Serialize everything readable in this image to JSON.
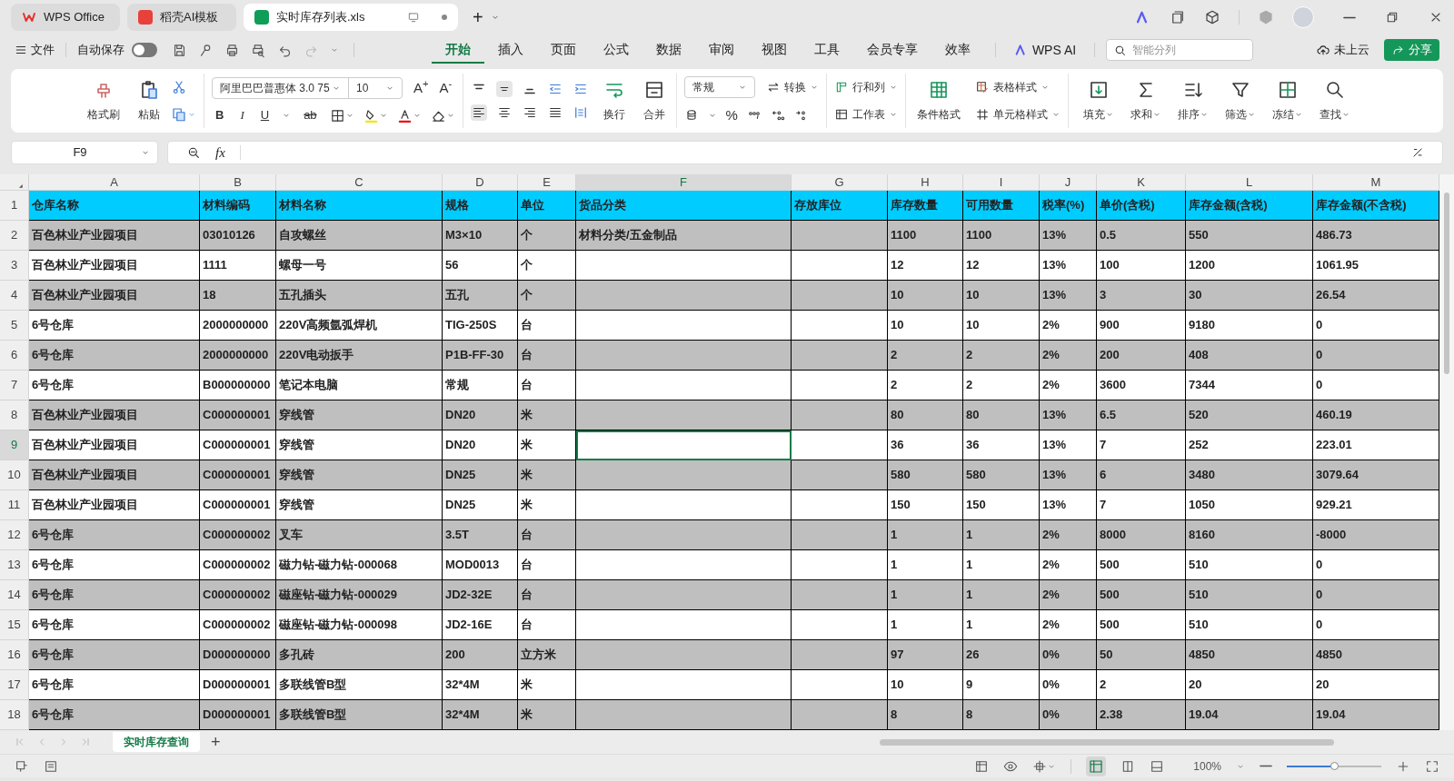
{
  "app_tabs": [
    {
      "label": "WPS Office",
      "selected": false
    },
    {
      "label": "稻壳AI模板",
      "selected": false
    },
    {
      "label": "实时库存列表.xls",
      "selected": true
    }
  ],
  "new_tab": "+",
  "menu": {
    "file": "文件",
    "autosave": {
      "label": "自动保存",
      "on": false
    },
    "tabs": [
      {
        "label": "开始",
        "selected": true
      },
      {
        "label": "插入",
        "selected": false
      },
      {
        "label": "页面",
        "selected": false
      },
      {
        "label": "公式",
        "selected": false
      },
      {
        "label": "数据",
        "selected": false
      },
      {
        "label": "审阅",
        "selected": false
      },
      {
        "label": "视图",
        "selected": false
      },
      {
        "label": "工具",
        "selected": false
      },
      {
        "label": "会员专享",
        "selected": false
      },
      {
        "label": "效率",
        "selected": false
      }
    ],
    "ai": "WPS AI",
    "search": {
      "placeholder": "智能分列"
    },
    "cloud": "未上云",
    "share": "分享"
  },
  "ribbon": {
    "format_painter": "格式刷",
    "paste": "粘贴",
    "font": "阿里巴巴普惠体 3.0 75",
    "font_size": "10",
    "font_grow": "A$^{+}$",
    "font_shrink": "A$^{-}$",
    "text_styles": [
      "B",
      "I",
      "U",
      "ab"
    ],
    "wrap": "换行",
    "merge": "合并",
    "number_format": "常规",
    "convert": "转换",
    "percent": "%",
    "rows_cols": "行和列",
    "worksheet": "工作表",
    "conditional": "条件格式",
    "table_style": "表格样式",
    "cell_style": "单元格样式",
    "tools": [
      "填充",
      "求和",
      "排序",
      "筛选",
      "冻结",
      "查找"
    ]
  },
  "formula_bar": {
    "cell": "F9",
    "fx": "fx"
  },
  "sheet": {
    "columns": [
      {
        "letter": "A",
        "selected": false
      },
      {
        "letter": "B",
        "selected": false
      },
      {
        "letter": "C",
        "selected": false
      },
      {
        "letter": "D",
        "selected": false
      },
      {
        "letter": "E",
        "selected": false
      },
      {
        "letter": "F",
        "selected": true
      },
      {
        "letter": "G",
        "selected": false
      },
      {
        "letter": "H",
        "selected": false
      },
      {
        "letter": "I",
        "selected": false
      },
      {
        "letter": "J",
        "selected": false
      },
      {
        "letter": "K",
        "selected": false
      },
      {
        "letter": "L",
        "selected": false
      },
      {
        "letter": "M",
        "selected": false
      }
    ],
    "rows": [
      {
        "number": "1",
        "kind": "header",
        "selected": false,
        "cells": [
          "仓库名称",
          "材料编码",
          "材料名称",
          "规格",
          "单位",
          "货品分类",
          "存放库位",
          "库存数量",
          "可用数量",
          "税率(%)",
          "单价(含税)",
          "库存金额(含税)",
          "库存金额(不含税)"
        ]
      },
      {
        "number": "2",
        "kind": "data",
        "shaded": true,
        "selected": false,
        "cells": [
          "百色林业产业园项目",
          "03010126",
          "自攻螺丝",
          "M3×10",
          "个",
          "材料分类/五金制品",
          null,
          "1100",
          "1100",
          "13%",
          "0.5",
          "550",
          "486.73"
        ]
      },
      {
        "number": "3",
        "kind": "data",
        "shaded": false,
        "selected": false,
        "cells": [
          "百色林业产业园项目",
          "1111",
          "螺母一号",
          "56",
          "个",
          null,
          null,
          "12",
          "12",
          "13%",
          "100",
          "1200",
          "1061.95"
        ]
      },
      {
        "number": "4",
        "kind": "data",
        "shaded": true,
        "selected": false,
        "cells": [
          "百色林业产业园项目",
          "18",
          "五孔插头",
          "五孔",
          "个",
          null,
          null,
          "10",
          "10",
          "13%",
          "3",
          "30",
          "26.54"
        ]
      },
      {
        "number": "5",
        "kind": "data",
        "shaded": false,
        "selected": false,
        "cells": [
          "6号仓库",
          "2000000000",
          "220V高频氩弧焊机",
          "TIG-250S",
          "台",
          null,
          null,
          "10",
          "10",
          "2%",
          "900",
          "9180",
          "0"
        ]
      },
      {
        "number": "6",
        "kind": "data",
        "shaded": true,
        "selected": false,
        "cells": [
          "6号仓库",
          "2000000000",
          "220V电动扳手",
          "P1B-FF-30",
          "台",
          null,
          null,
          "2",
          "2",
          "2%",
          "200",
          "408",
          "0"
        ]
      },
      {
        "number": "7",
        "kind": "data",
        "shaded": false,
        "selected": false,
        "cells": [
          "6号仓库",
          "B000000000",
          "笔记本电脑",
          "常规",
          "台",
          null,
          null,
          "2",
          "2",
          "2%",
          "3600",
          "7344",
          "0"
        ]
      },
      {
        "number": "8",
        "kind": "data",
        "shaded": true,
        "selected": false,
        "cells": [
          "百色林业产业园项目",
          "C000000001",
          "穿线管",
          "DN20",
          "米",
          null,
          null,
          "80",
          "80",
          "13%",
          "6.5",
          "520",
          "460.19"
        ]
      },
      {
        "number": "9",
        "kind": "data",
        "shaded": false,
        "selected": true,
        "cells": [
          "百色林业产业园项目",
          "C000000001",
          "穿线管",
          "DN20",
          "米",
          null,
          null,
          "36",
          "36",
          "13%",
          "7",
          "252",
          "223.01"
        ]
      },
      {
        "number": "10",
        "kind": "data",
        "shaded": true,
        "selected": false,
        "cells": [
          "百色林业产业园项目",
          "C000000001",
          "穿线管",
          "DN25",
          "米",
          null,
          null,
          "580",
          "580",
          "13%",
          "6",
          "3480",
          "3079.64"
        ]
      },
      {
        "number": "11",
        "kind": "data",
        "shaded": false,
        "selected": false,
        "cells": [
          "百色林业产业园项目",
          "C000000001",
          "穿线管",
          "DN25",
          "米",
          null,
          null,
          "150",
          "150",
          "13%",
          "7",
          "1050",
          "929.21"
        ]
      },
      {
        "number": "12",
        "kind": "data",
        "shaded": true,
        "selected": false,
        "cells": [
          "6号仓库",
          "C000000002",
          "叉车",
          "3.5T",
          "台",
          null,
          null,
          "1",
          "1",
          "2%",
          "8000",
          "8160",
          "-8000"
        ]
      },
      {
        "number": "13",
        "kind": "data",
        "shaded": false,
        "selected": false,
        "cells": [
          "6号仓库",
          "C000000002",
          "磁力钻-磁力钻-000068",
          "MOD0013",
          "台",
          null,
          null,
          "1",
          "1",
          "2%",
          "500",
          "510",
          "0"
        ]
      },
      {
        "number": "14",
        "kind": "data",
        "shaded": true,
        "selected": false,
        "cells": [
          "6号仓库",
          "C000000002",
          "磁座钻-磁力钻-000029",
          "JD2-32E",
          "台",
          null,
          null,
          "1",
          "1",
          "2%",
          "500",
          "510",
          "0"
        ]
      },
      {
        "number": "15",
        "kind": "data",
        "shaded": false,
        "selected": false,
        "cells": [
          "6号仓库",
          "C000000002",
          "磁座钻-磁力钻-000098",
          "JD2-16E",
          "台",
          null,
          null,
          "1",
          "1",
          "2%",
          "500",
          "510",
          "0"
        ]
      },
      {
        "number": "16",
        "kind": "data",
        "shaded": true,
        "selected": false,
        "cells": [
          "6号仓库",
          "D000000000",
          "多孔砖",
          "200",
          "立方米",
          null,
          null,
          "97",
          "26",
          "0%",
          "50",
          "4850",
          "4850"
        ]
      },
      {
        "number": "17",
        "kind": "data",
        "shaded": false,
        "selected": false,
        "cells": [
          "6号仓库",
          "D000000001",
          "多联线管B型",
          "32*4M",
          "米",
          null,
          null,
          "10",
          "9",
          "0%",
          "2",
          "20",
          "20"
        ]
      },
      {
        "number": "18",
        "kind": "data",
        "shaded": true,
        "selected": false,
        "cells": [
          "6号仓库",
          "D000000001",
          "多联线管B型",
          "32*4M",
          "米",
          null,
          null,
          "8",
          "8",
          "0%",
          "2.38",
          "19.04",
          "19.04"
        ]
      }
    ]
  },
  "sheet_tabs": [
    {
      "label": "实时库存查询",
      "selected": true
    }
  ],
  "add_sheet": "+",
  "zoom": {
    "reading": "100%",
    "level": 0.5
  }
}
